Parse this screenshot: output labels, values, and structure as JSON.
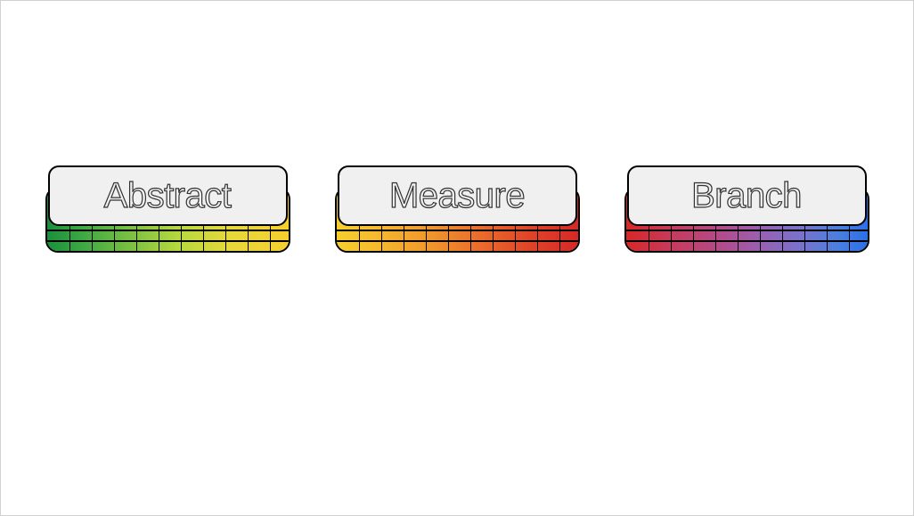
{
  "cards": [
    {
      "label": "Abstract",
      "gradient_class": "grad-0"
    },
    {
      "label": "Measure",
      "gradient_class": "grad-1"
    },
    {
      "label": "Branch",
      "gradient_class": "grad-2"
    }
  ]
}
